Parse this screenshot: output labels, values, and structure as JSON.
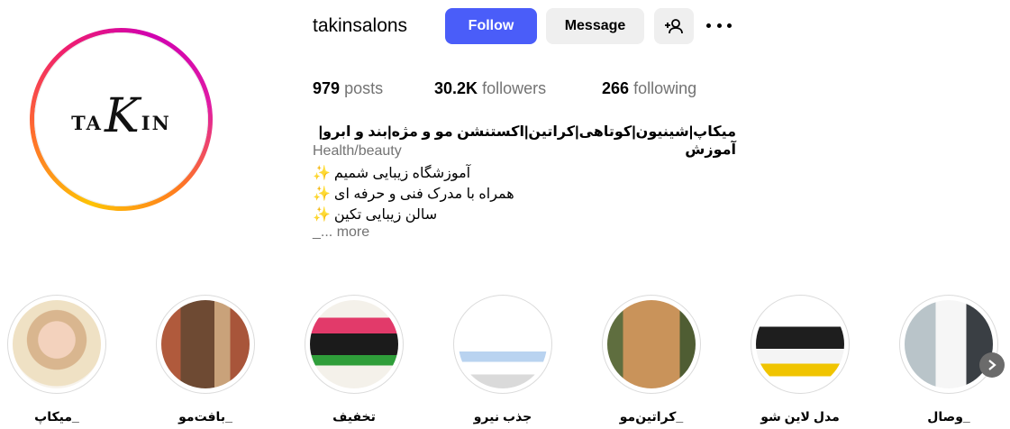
{
  "profile": {
    "username": "takinsalons",
    "avatar_logo_left": "TA",
    "avatar_logo_k": "K",
    "avatar_logo_right": "IN"
  },
  "actions": {
    "follow_label": "Follow",
    "message_label": "Message",
    "add_user_icon": "add-user-icon",
    "more_icon": "more-options-icon"
  },
  "stats": {
    "posts_count": "979",
    "posts_label": "posts",
    "followers_count": "30.2K",
    "followers_label": "followers",
    "following_count": "266",
    "following_label": "following"
  },
  "bio": {
    "name": "میکاپ|شینیون|کوتاهی|کراتین|اکستنشن مو و مژه|بند و ابرو|آموزش",
    "category": "Health/beauty",
    "lines": [
      "آموزشگاه زیبایی شمیم",
      "همراه با مدرک فنی و حرفه ای",
      "سالن زیبایی تکین"
    ],
    "sparkle": "✨",
    "trailing": "_...",
    "more_label": "more"
  },
  "highlights": [
    {
      "label": "_میکاپ"
    },
    {
      "label": "_بافت‌مو"
    },
    {
      "label": "تخفیف"
    },
    {
      "label": "جذب نیرو"
    },
    {
      "label": "_کراتین‌مو"
    },
    {
      "label": "مدل لاین شو"
    },
    {
      "label": "_وصال"
    }
  ],
  "colors": {
    "follow_button": "#4a5df9",
    "secondary_button": "#efefef",
    "muted_text": "#737373",
    "ring_gradient": [
      "#fdc305",
      "#ff6f2c",
      "#f0206d",
      "#d000b0"
    ]
  }
}
